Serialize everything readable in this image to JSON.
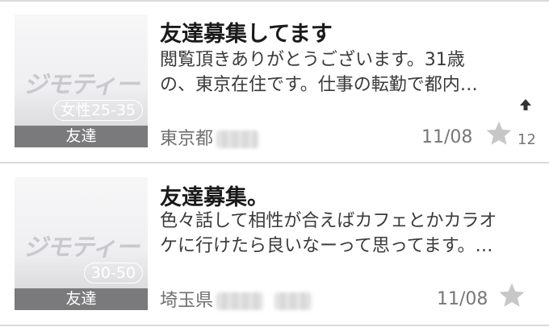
{
  "listings": [
    {
      "thumb_logo": "ジモティー",
      "thumb_range": "女性25-35",
      "category": "友達",
      "title": "友達募集してます",
      "desc_line1": "閲覧頂きありがとうございます。31歳",
      "desc_line2": "の、東京在住です。仕事の転勤で都内…",
      "location": "東京都",
      "date": "11/08",
      "favorite_count": "12"
    },
    {
      "thumb_logo": "ジモティー",
      "thumb_range": "30-50",
      "category": "友達",
      "title": "友達募集。",
      "desc_line1": "色々話して相性が合えばカフェとかカラオ",
      "desc_line2": "ケに行けたら良いなーって思ってます。…",
      "location": "埼玉県",
      "date": "11/08"
    }
  ],
  "icons": {
    "favorite": "star-icon",
    "scroll_top": "arrow-up-icon"
  },
  "colors": {
    "star": "#c7c7c7",
    "category_band": "#7a7a7c"
  }
}
